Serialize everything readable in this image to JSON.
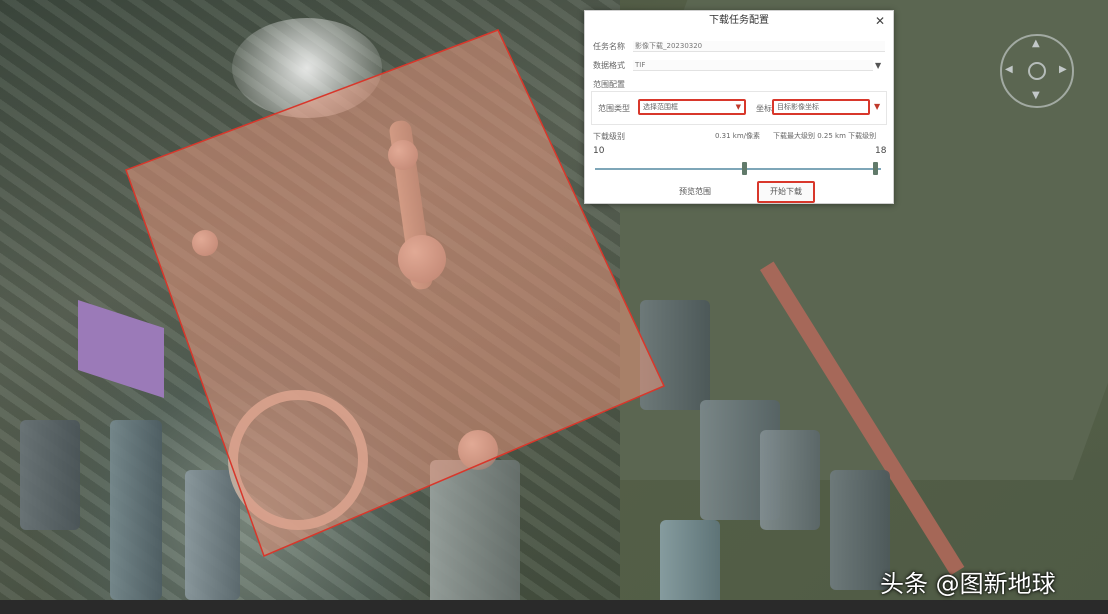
{
  "dialog": {
    "title": "下载任务配置",
    "close_icon": "close-icon",
    "task_name_label": "任务名称",
    "task_name_value": "影像下载_20230320",
    "mode_label": "数据格式",
    "mode_value": "TIF",
    "range_section_label": "范围配置",
    "range_type_label": "范围类型",
    "range_type_value": "选择范围框",
    "coordinate_label": "坐标",
    "coordinate_value": "目标影像坐标",
    "level_label": "下载级别",
    "level_hint_left": "0.31 km/像素",
    "level_hint_right": "下载最大级别 0.25 km 下载级别",
    "level_min": "10",
    "level_max": "18",
    "level_start_fraction": 0.52,
    "level_end_fraction": 0.98,
    "preview_button": "预览范围",
    "start_button": "开始下载"
  },
  "colors": {
    "highlight": "#d8372b",
    "selection_fill": "#e8957c"
  },
  "map": {
    "compass_icon": "compass-icon"
  },
  "watermark": "头条 @图新地球"
}
